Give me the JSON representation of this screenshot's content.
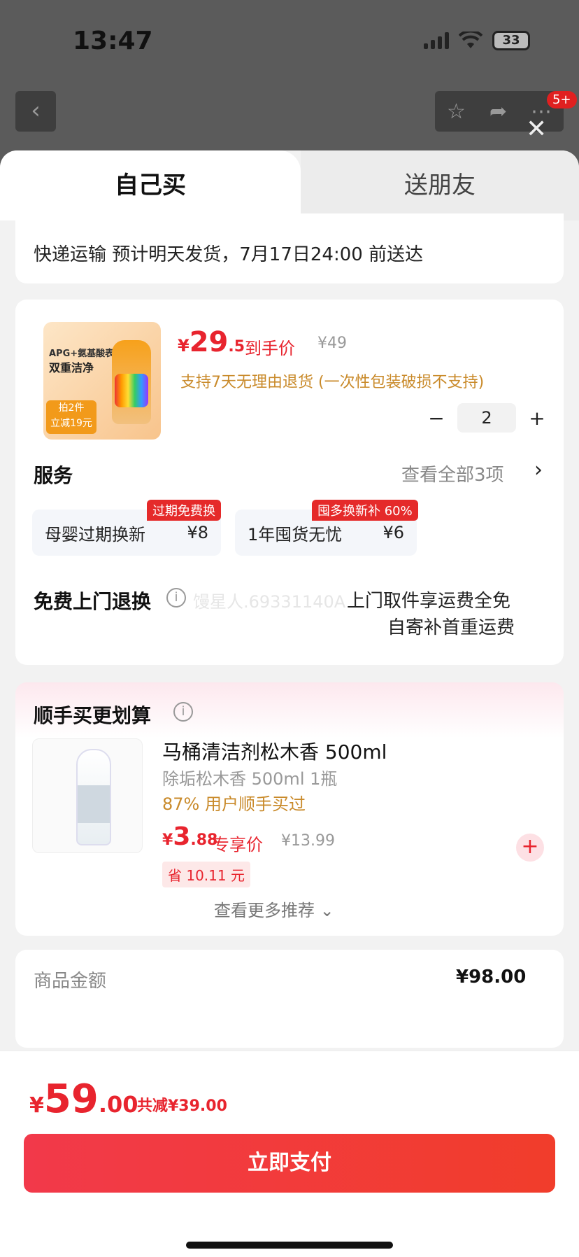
{
  "status": {
    "time": "13:47",
    "battery": "33"
  },
  "top": {
    "badge": "5+",
    "back": "‹",
    "close": "✕"
  },
  "tabs": {
    "self": "自己买",
    "friend": "送朋友"
  },
  "shipping": {
    "text": "快递运输 预计明天发货，7月17日24:00 前送达"
  },
  "product": {
    "img_line1": "APG+氨基酸表活",
    "img_line2": "双重洁净",
    "img_promo": "拍2件\n立减19元",
    "currency": "¥",
    "price_int": "29",
    "price_dec": ".5",
    "price_tag": "到手价",
    "price_old": "¥49",
    "refund": "支持7天无理由退货 (一次性包装破损不支持)",
    "qty_minus": "−",
    "qty": "2",
    "qty_plus": "+"
  },
  "services": {
    "title": "服务",
    "more": "查看全部3项",
    "items": [
      {
        "tag": "过期免费换",
        "name": "母婴过期换新",
        "price": "¥8"
      },
      {
        "tag": "囤多换新补 60%",
        "name": "1年囤货无忧",
        "price": "¥6"
      }
    ],
    "door_title": "免费上门退换",
    "door_line1": "上门取件享运费全免",
    "door_line2": "自寄补首重运费",
    "watermark": "馒星人.69331140A"
  },
  "addon": {
    "title": "顺手买更划算",
    "name": "马桶清洁剂松木香 500ml",
    "spec": "除垢松木香 500ml 1瓶",
    "bought": "87% 用户顺手买过",
    "currency": "¥",
    "price_int": "3",
    "price_dec": ".88",
    "price_tag": "专享价",
    "price_old": "¥13.99",
    "save": "省 10.11 元",
    "more": "查看更多推荐 ⌄"
  },
  "summary": {
    "label": "商品金额",
    "value": "¥98.00"
  },
  "footer": {
    "currency": "¥",
    "total_int": "59",
    "total_dec": ".00",
    "total_save": "共减¥39.00",
    "pay": "立即支付"
  }
}
